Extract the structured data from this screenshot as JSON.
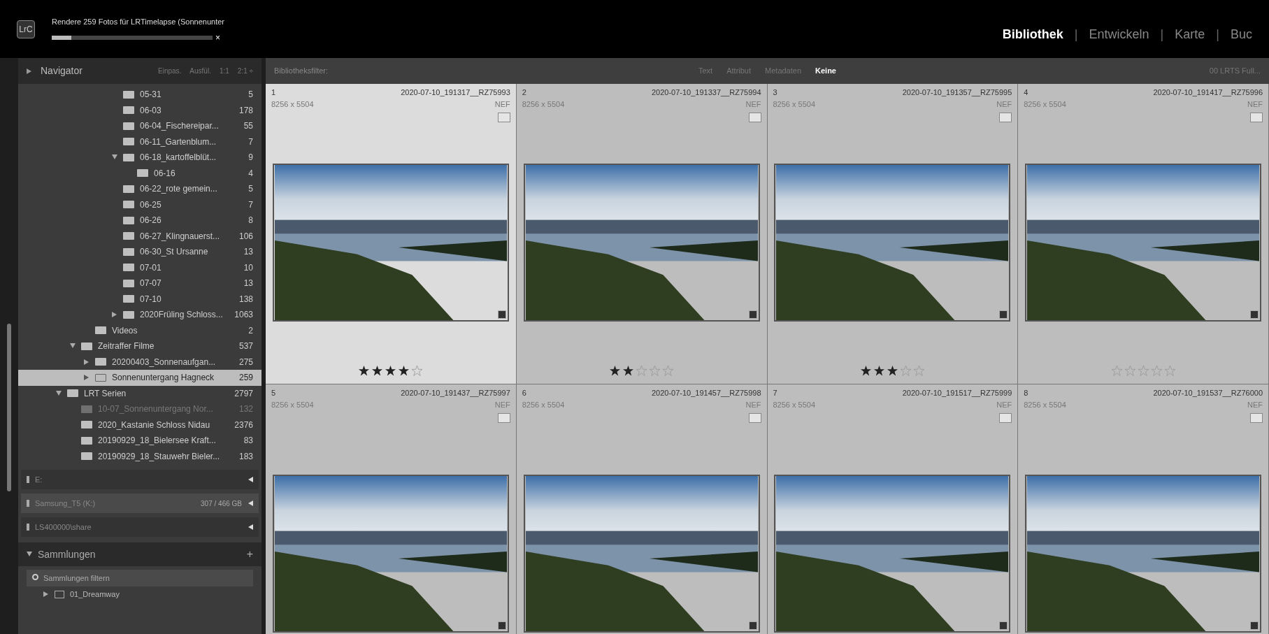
{
  "topbar": {
    "logo": "LrC",
    "task": "Rendere 259 Fotos für LRTimelapse (Sonnenunter",
    "progress": {
      "level": 0.12
    },
    "cancel": "×",
    "modules": [
      {
        "label": "Bibliothek",
        "selected": true
      },
      {
        "label": "Entwickeln",
        "selected": false
      },
      {
        "label": "Karte",
        "selected": false
      },
      {
        "label": "Buc",
        "selected": false
      }
    ],
    "separator": "|"
  },
  "navigator": {
    "title": "Navigator",
    "expanded": false,
    "options": [
      "Einpas.",
      "Ausfül.",
      "1:1",
      "2:1 ÷"
    ]
  },
  "tree": [
    {
      "children": [
        {
          "children": [
            {
              "children": [
                {
                  "children": [
                    {
                      "label": "05-31",
                      "count": "5",
                      "selected": false,
                      "dimmed": false
                    },
                    {
                      "label": "06-03",
                      "count": "178",
                      "selected": false,
                      "dimmed": false
                    },
                    {
                      "label": "06-04_Fischereipar...",
                      "count": "55",
                      "selected": false,
                      "dimmed": false
                    },
                    {
                      "label": "06-11_Gartenblum...",
                      "count": "7",
                      "selected": false,
                      "dimmed": false
                    },
                    {
                      "label": "06-18_kartoffelblüt...",
                      "count": "9",
                      "selected": false,
                      "dimmed": false,
                      "expanded": true,
                      "children": [
                        {
                          "label": "06-16",
                          "count": "4",
                          "selected": false,
                          "dimmed": false
                        }
                      ]
                    },
                    {
                      "label": "06-22_rote gemein...",
                      "count": "5",
                      "selected": false,
                      "dimmed": false
                    },
                    {
                      "label": "06-25",
                      "count": "7",
                      "selected": false,
                      "dimmed": false
                    },
                    {
                      "label": "06-26",
                      "count": "8",
                      "selected": false,
                      "dimmed": false
                    },
                    {
                      "label": "06-27_Klingnauerst...",
                      "count": "106",
                      "selected": false,
                      "dimmed": false
                    },
                    {
                      "label": "06-30_St Ursanne",
                      "count": "13",
                      "selected": false,
                      "dimmed": false
                    },
                    {
                      "label": "07-01",
                      "count": "10",
                      "selected": false,
                      "dimmed": false
                    },
                    {
                      "label": "07-07",
                      "count": "13",
                      "selected": false,
                      "dimmed": false
                    },
                    {
                      "label": "07-10",
                      "count": "138",
                      "selected": false,
                      "dimmed": false
                    },
                    {
                      "label": "2020Früling Schloss...",
                      "count": "1063",
                      "selected": false,
                      "dimmed": false,
                      "expanded": false
                    }
                  ]
                }
              ]
            },
            {
              "label": "Videos",
              "count": "2",
              "selected": false,
              "dimmed": false
            }
          ]
        },
        {
          "label": "Zeitraffer Filme",
          "count": "537",
          "selected": false,
          "dimmed": false,
          "expanded": true,
          "children": [
            {
              "label": "20200403_Sonnenaufgan...",
              "count": "275",
              "selected": false,
              "dimmed": false,
              "expanded": false
            },
            {
              "label": "Sonnenuntergang Hagneck",
              "count": "259",
              "selected": true,
              "dimmed": false,
              "expanded": false
            }
          ]
        }
      ]
    },
    {
      "label": "LRT Serien",
      "count": "2797",
      "selected": false,
      "dimmed": false,
      "expanded": true,
      "children": [
        {
          "label": "10-07_Sonnenuntergang Nor...",
          "count": "132",
          "selected": false,
          "dimmed": true
        },
        {
          "label": "2020_Kastanie Schloss Nidau",
          "count": "2376",
          "selected": false,
          "dimmed": false
        },
        {
          "label": "20190929_18_Bielersee Kraft...",
          "count": "83",
          "selected": false,
          "dimmed": false
        },
        {
          "label": "20190929_18_Stauwehr Bieler...",
          "count": "183",
          "selected": false,
          "dimmed": false
        }
      ]
    }
  ],
  "volumes": [
    {
      "name": "E:",
      "highlighted": false
    },
    {
      "name": "Samsung_T5 (K:)",
      "space": "307 / 466 GB",
      "highlighted": true
    },
    {
      "name": "LS400000\\share",
      "highlighted": false
    }
  ],
  "collections": {
    "title": "Sammlungen",
    "expanded": true,
    "add": "+",
    "filter_placeholder": "Sammlungen filtern",
    "items": [
      {
        "label": "01_Dreamway",
        "expanded": false
      }
    ]
  },
  "filterbar": {
    "label": "Bibliotheksfilter:",
    "tabs": [
      {
        "label": "Text",
        "selected": false
      },
      {
        "label": "Attribut",
        "selected": false
      },
      {
        "label": "Metadaten",
        "selected": false
      },
      {
        "label": "Keine",
        "selected": true
      }
    ],
    "preset": "00 LRTS Full..."
  },
  "photos": [
    {
      "index": "1",
      "filename": "2020-07-10_191317__RZ75993",
      "dimensions": "8256 x 5504",
      "format": "NEF",
      "stars": 4,
      "selected": true
    },
    {
      "index": "2",
      "filename": "2020-07-10_191337__RZ75994",
      "dimensions": "8256 x 5504",
      "format": "NEF",
      "stars": 2,
      "selected": false
    },
    {
      "index": "3",
      "filename": "2020-07-10_191357__RZ75995",
      "dimensions": "8256 x 5504",
      "format": "NEF",
      "stars": 3,
      "selected": false
    },
    {
      "index": "4",
      "filename": "2020-07-10_191417__RZ75996",
      "dimensions": "8256 x 5504",
      "format": "NEF",
      "stars": 0,
      "selected": false
    },
    {
      "index": "5",
      "filename": "2020-07-10_191437__RZ75997",
      "dimensions": "8256 x 5504",
      "format": "NEF",
      "selected": false
    },
    {
      "index": "6",
      "filename": "2020-07-10_191457__RZ75998",
      "dimensions": "8256 x 5504",
      "format": "NEF",
      "selected": false
    },
    {
      "index": "7",
      "filename": "2020-07-10_191517__RZ75999",
      "dimensions": "8256 x 5504",
      "format": "NEF",
      "selected": false
    },
    {
      "index": "8",
      "filename": "2020-07-10_191537__RZ76000",
      "dimensions": "8256 x 5504",
      "format": "NEF",
      "selected": false
    }
  ]
}
